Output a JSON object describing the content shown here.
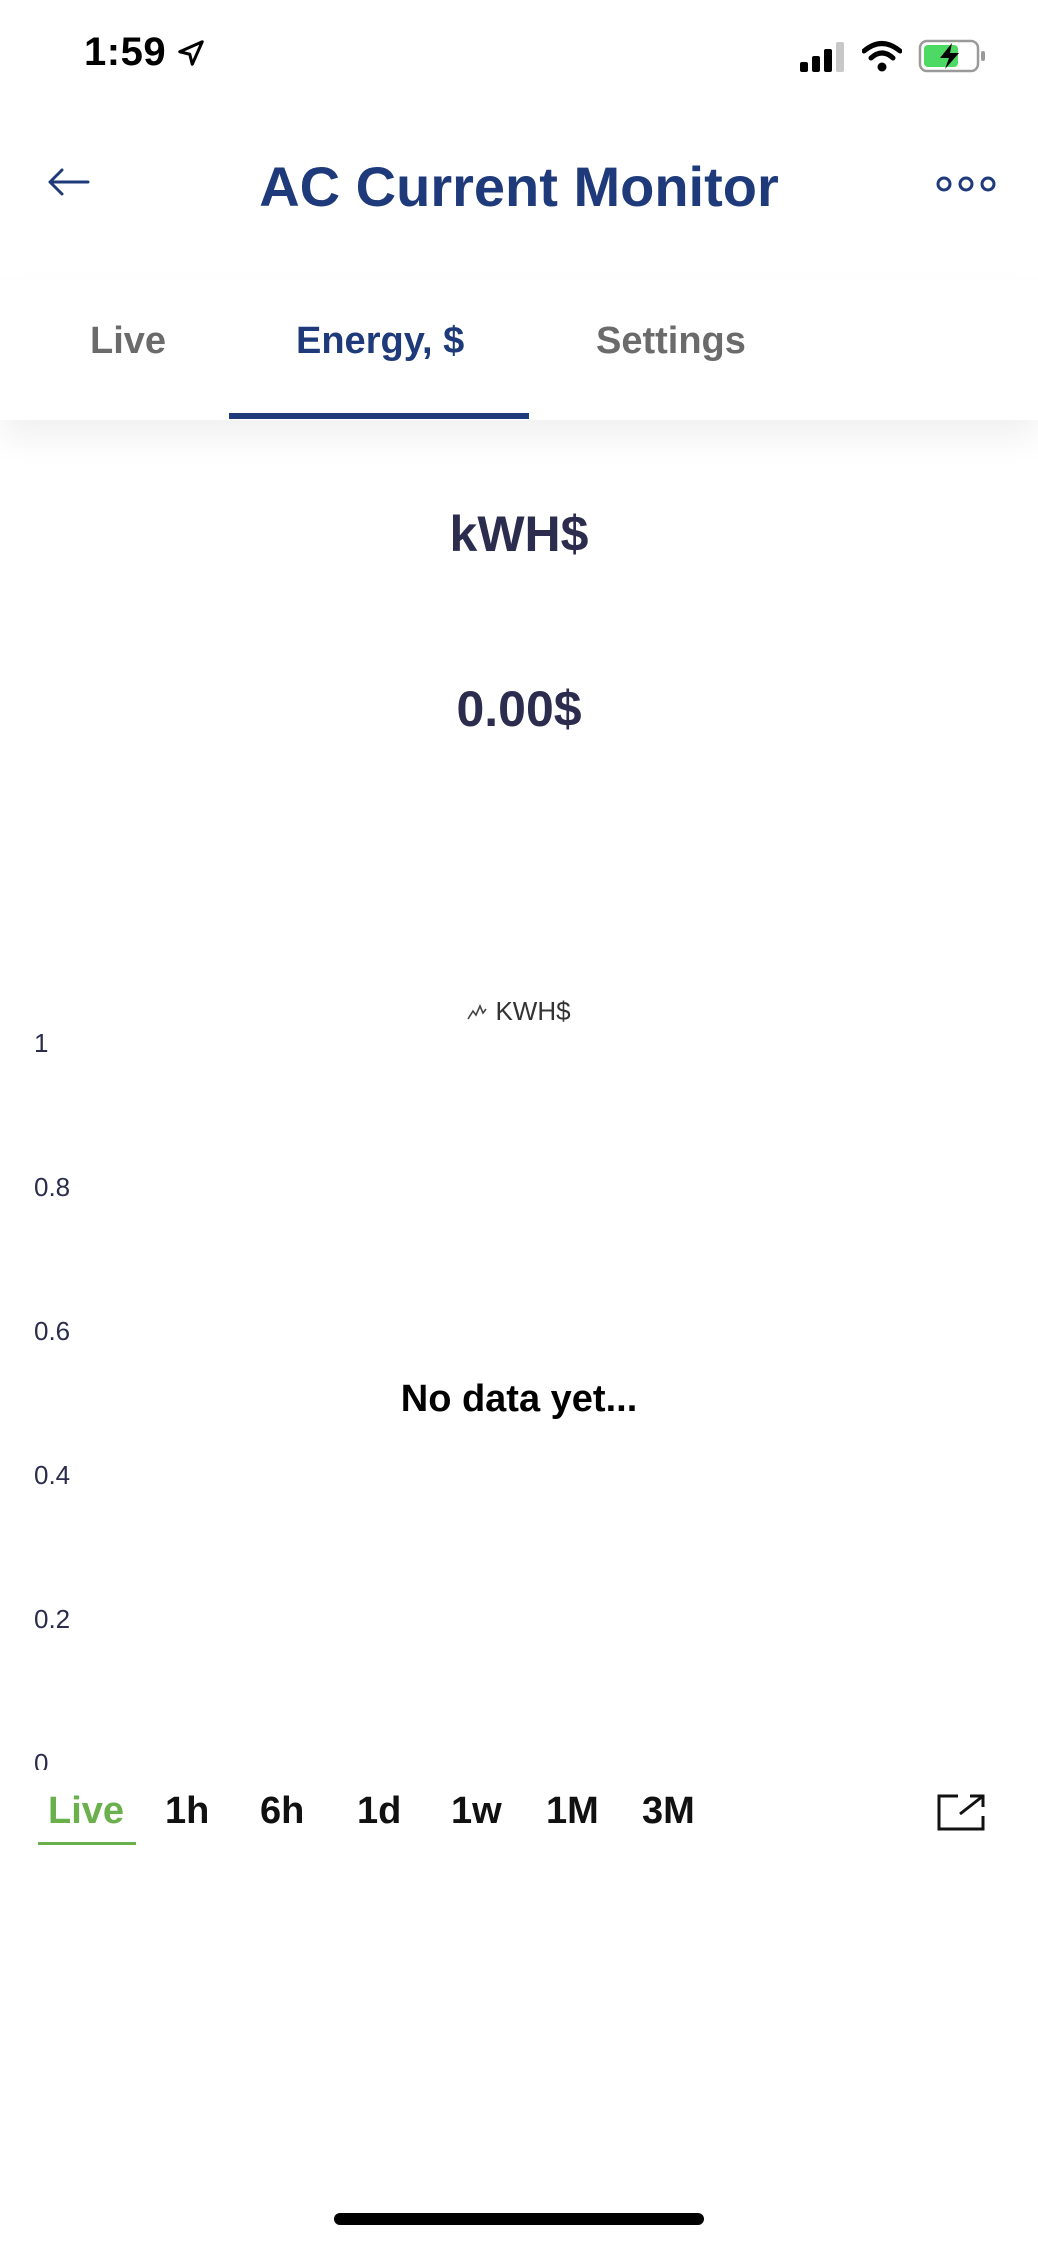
{
  "status_bar": {
    "time": "1:59"
  },
  "header": {
    "title": "AC Current Monitor"
  },
  "tabs": [
    {
      "label": "Live"
    },
    {
      "label": "Energy, $"
    },
    {
      "label": "Settings"
    }
  ],
  "main": {
    "unit_label": "kWH$",
    "value": "0.00$"
  },
  "chart_data": {
    "type": "line",
    "legend": [
      "KWH$"
    ],
    "y_ticks": [
      "1",
      "0.8",
      "0.6",
      "0.4",
      "0.2",
      "0"
    ],
    "ylim": [
      0,
      1
    ],
    "series": [],
    "empty_message": "No data yet..."
  },
  "range_selector": {
    "options": [
      "Live",
      "1h",
      "6h",
      "1d",
      "1w",
      "1M",
      "3M"
    ],
    "selected": "Live"
  },
  "colors": {
    "primary": "#1e3a7a",
    "active_range": "#6ab04c"
  }
}
